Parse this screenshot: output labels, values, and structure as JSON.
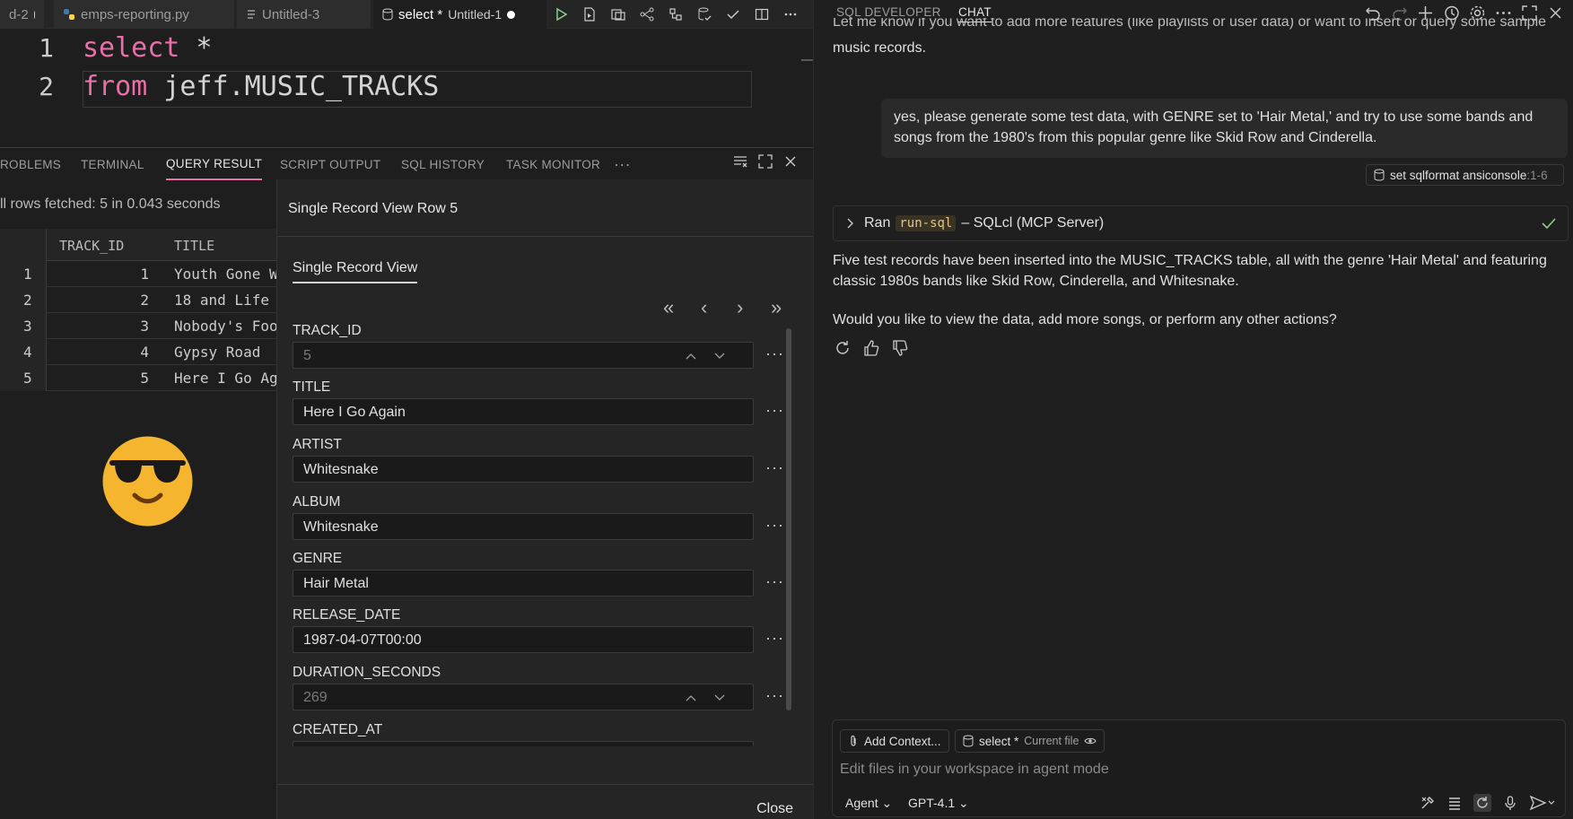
{
  "editor": {
    "tabs": [
      {
        "label": "d-2"
      },
      {
        "label": "emps-reporting.py"
      },
      {
        "label": "Untitled-3"
      },
      {
        "label": "select *",
        "sub": "Untitled-1"
      }
    ],
    "lines": [
      {
        "num": "1",
        "kw": "select",
        "rest": " *"
      },
      {
        "num": "2",
        "kw": "from",
        "rest": " jeff.MUSIC_TRACKS"
      }
    ]
  },
  "panel": {
    "tabs": [
      "ROBLEMS",
      "TERMINAL",
      "QUERY RESULT",
      "SCRIPT OUTPUT",
      "SQL HISTORY",
      "TASK MONITOR"
    ],
    "more": "···",
    "rows_fetched": "ll rows fetched: 5 in 0.043 seconds",
    "columns": [
      "TRACK_ID",
      "TITLE"
    ],
    "rows": [
      {
        "n": "1",
        "id": "1",
        "title": "Youth Gone W"
      },
      {
        "n": "2",
        "id": "2",
        "title": "18 and Life"
      },
      {
        "n": "3",
        "id": "3",
        "title": "Nobody's Foo"
      },
      {
        "n": "4",
        "id": "4",
        "title": "Gypsy Road"
      },
      {
        "n": "5",
        "id": "5",
        "title": "Here I Go Ag"
      }
    ]
  },
  "dialog": {
    "title": "Single Record View Row 5",
    "tab": "Single Record View",
    "nav": {
      "first": "«",
      "prev": "‹",
      "next": "›",
      "last": "»"
    },
    "fields": [
      {
        "label": "TRACK_ID",
        "value": "5"
      },
      {
        "label": "TITLE",
        "value": "Here I Go Again"
      },
      {
        "label": "ARTIST",
        "value": "Whitesnake"
      },
      {
        "label": "ALBUM",
        "value": "Whitesnake"
      },
      {
        "label": "GENRE",
        "value": "Hair Metal"
      },
      {
        "label": "RELEASE_DATE",
        "value": "1987-04-07T00:00"
      },
      {
        "label": "DURATION_SECONDS",
        "value": "269"
      },
      {
        "label": "CREATED_AT",
        "value": ""
      }
    ],
    "more": "···",
    "close_label": "Close"
  },
  "chat": {
    "tabs": [
      "SQL DEVELOPER",
      "CHAT"
    ],
    "intro_line1": "Let me know if you want to add more features (like playlists or user data) or want to insert or query some sample",
    "intro_line2": "music records.",
    "user_message_line1": "yes, please generate some test data, with GENRE set to 'Hair Metal,' and try to use some bands and",
    "user_message_line2": "songs from the 1980's from this popular genre like Skid Row and Cinderella.",
    "ref": {
      "name": "set sqlformat ansiconsole",
      "range": ":1-6"
    },
    "ran": {
      "prefix": "Ran",
      "tool": "run-sql",
      "suffix": "– SQLcl (MCP Server)"
    },
    "response_line1": "Five test records have been inserted into the MUSIC_TRACKS table, all with the genre 'Hair Metal' and featuring",
    "response_line2": "classic 1980s bands like Skid Row, Cinderella, and Whitesnake.",
    "question": "Would you like to view the data, add more songs, or perform any other actions?",
    "input": {
      "add_context": "Add Context...",
      "file_chip": "select *",
      "file_chip_sub": "Current file",
      "placeholder": "Edit files in your workspace in agent mode",
      "mode": "Agent",
      "model": "GPT-4.1"
    }
  },
  "colors": {
    "accent": "#e86fa8",
    "check": "#89d185"
  }
}
